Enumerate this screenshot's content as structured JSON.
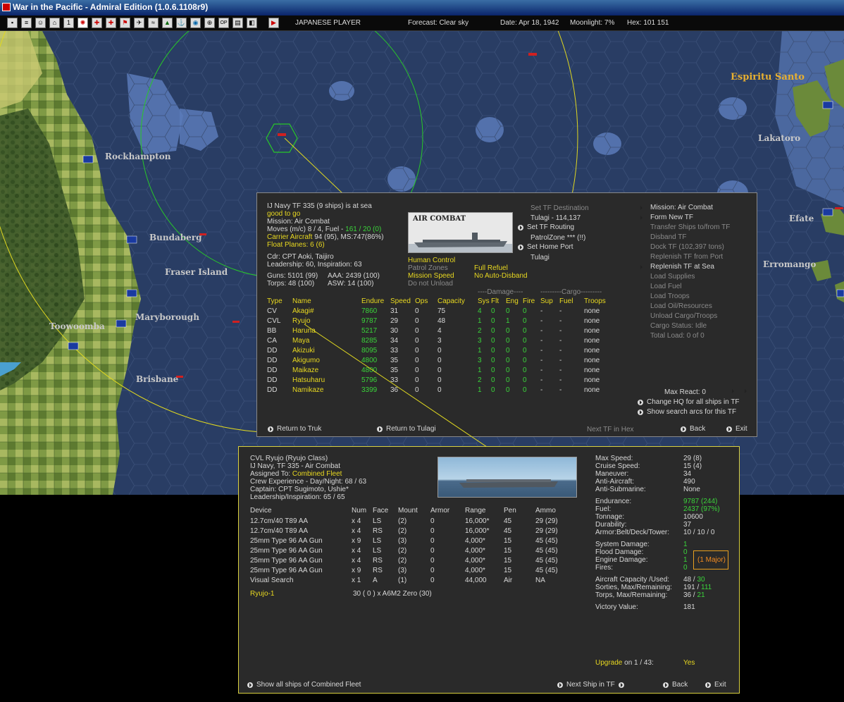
{
  "window": {
    "title": "War in the Pacific - Admiral Edition (1.0.6.1108r9)"
  },
  "topbar": {
    "player": "JAPANESE PLAYER",
    "forecast": "Forecast: Clear sky",
    "date": "Date: Apr 18, 1942",
    "moonlight": "Moonlight: 7%",
    "hex": "Hex: 101 151"
  },
  "map": {
    "labels": [
      "Rockhampton",
      "Bundaberg",
      "Fraser Island",
      "Maryborough",
      "Toowoomba",
      "Brisbane",
      "Espiritu Santo",
      "Lakatoro",
      "Efate",
      "Erromango"
    ]
  },
  "tf_panel": {
    "header": "IJ Navy TF 335 (9 ships) is at sea",
    "status": "good to go",
    "mission": "Mission: Air Combat",
    "moves": "Moves (m/c) 8 / 4, Fuel - ",
    "fuel": "161 / 20 (0)",
    "carrier": "Carrier Aircraft",
    "carrier_val": " 94 (95), MS:747(86%)",
    "float": "Float Planes: 6 (6)",
    "cdr": "Cdr: CPT Aoki, Taijiro",
    "leadership": "Leadership: 60, Inspiration: 63",
    "guns": "Guns: 5101 (99)",
    "aaa": "AAA: 2439 (100)",
    "torps": "Torps: 48 (100)",
    "asw": "ASW: 14 (100)",
    "image_caption": "AIR COMBAT",
    "human_control": "Human Control",
    "patrol_zones": "Patrol Zones",
    "mission_speed": "Mission Speed",
    "do_not_unload": "Do not Unload",
    "full_refuel": "Full Refuel",
    "no_auto_disband": "No Auto-Disband",
    "set_destination": "Set TF Destination",
    "destination": "Tulagi - 114,137",
    "set_routing": "Set TF Routing",
    "patrol_zone": "PatrolZone *** (!!)",
    "set_home": "Set Home Port",
    "home": "Tulagi",
    "right_menu": [
      {
        "label": "Mission: Air Combat",
        "active": true
      },
      {
        "label": "Form New TF",
        "active": true
      },
      {
        "label": "Transfer Ships to/from TF",
        "active": false
      },
      {
        "label": "Disband TF",
        "active": false
      },
      {
        "label": "Dock TF (102,397 tons)",
        "active": false
      },
      {
        "label": "Replenish TF from Port",
        "active": false
      },
      {
        "label": "Replenish TF at Sea",
        "active": true
      },
      {
        "label": "Load Supplies",
        "active": false
      },
      {
        "label": "Load Fuel",
        "active": false
      },
      {
        "label": "Load Troops",
        "active": false
      },
      {
        "label": "Load Oil/Resources",
        "active": false
      },
      {
        "label": "Unload Cargo/Troops",
        "active": false
      },
      {
        "label": "Cargo Status: Idle",
        "active": false
      },
      {
        "label": "Total Load: 0 of 0",
        "active": false
      }
    ],
    "group_damage": "----Damage----",
    "group_cargo": "---------Cargo---------",
    "columns": [
      "Type",
      "Name",
      "Endure",
      "Speed",
      "Ops",
      "Capacity",
      "Sys",
      "Flt",
      "Eng",
      "Fire",
      "Sup",
      "Fuel",
      "Troops"
    ],
    "ships": [
      [
        "CV",
        "Akagi#",
        "7860",
        "31",
        "0",
        "75",
        "4",
        "0",
        "0",
        "0",
        "-",
        "-",
        "none"
      ],
      [
        "CVL",
        "Ryujo",
        "9787",
        "29",
        "0",
        "48",
        "1",
        "0",
        "1",
        "0",
        "-",
        "-",
        "none"
      ],
      [
        "BB",
        "Haruna",
        "5217",
        "30",
        "0",
        "4",
        "2",
        "0",
        "0",
        "0",
        "-",
        "-",
        "none"
      ],
      [
        "CA",
        "Maya",
        "8285",
        "34",
        "0",
        "3",
        "3",
        "0",
        "0",
        "0",
        "-",
        "-",
        "none"
      ],
      [
        "DD",
        "Akizuki",
        "8095",
        "33",
        "0",
        "0",
        "1",
        "0",
        "0",
        "0",
        "-",
        "-",
        "none"
      ],
      [
        "DD",
        "Akigumo",
        "4800",
        "35",
        "0",
        "0",
        "3",
        "0",
        "0",
        "0",
        "-",
        "-",
        "none"
      ],
      [
        "DD",
        "Maikaze",
        "4800",
        "35",
        "0",
        "0",
        "1",
        "0",
        "0",
        "0",
        "-",
        "-",
        "none"
      ],
      [
        "DD",
        "Hatsuharu",
        "5796",
        "33",
        "0",
        "0",
        "2",
        "0",
        "0",
        "0",
        "-",
        "-",
        "none"
      ],
      [
        "DD",
        "Namikaze",
        "3399",
        "36",
        "0",
        "0",
        "1",
        "0",
        "0",
        "0",
        "-",
        "-",
        "none"
      ]
    ],
    "max_react": "Max React:  0",
    "change_hq": "Change HQ for all ships in TF",
    "show_search": "Show search arcs for this TF",
    "return_truk": "Return to Truk",
    "return_tulagi": "Return to Tulagi",
    "next_tf": "Next TF in Hex",
    "back": "Back",
    "exit": "Exit"
  },
  "ship_panel": {
    "title": "CVL Ryujo (Ryujo Class)",
    "tf": "IJ Navy, TF 335 - Air Combat",
    "assigned_label": "Assigned To: ",
    "assigned": "Combined Fleet",
    "crew": "Crew Experience - Day/Night: 68 / 63",
    "captain": "Captain: CPT Sugimoto, Ushie*",
    "leadership": "Leadership/Inspiration: 65 / 65",
    "columns": [
      "Device",
      "Num",
      "Face",
      "Mount",
      "Armor",
      "Range",
      "Pen",
      "Ammo"
    ],
    "devices": [
      [
        "12.7cm/40 T89 AA",
        "x 4",
        "LS",
        "(2)",
        "0",
        "16,000*",
        "45",
        "29  (29)"
      ],
      [
        "12.7cm/40 T89 AA",
        "x 4",
        "RS",
        "(2)",
        "0",
        "16,000*",
        "45",
        "29  (29)"
      ],
      [
        "25mm Type 96 AA Gun",
        "x 9",
        "LS",
        "(3)",
        "0",
        "4,000*",
        "15",
        "45  (45)"
      ],
      [
        "25mm Type 96 AA Gun",
        "x 4",
        "LS",
        "(2)",
        "0",
        "4,000*",
        "15",
        "45  (45)"
      ],
      [
        "25mm Type 96 AA Gun",
        "x 4",
        "RS",
        "(2)",
        "0",
        "4,000*",
        "15",
        "45  (45)"
      ],
      [
        "25mm Type 96 AA Gun",
        "x 9",
        "RS",
        "(3)",
        "0",
        "4,000*",
        "15",
        "45  (45)"
      ],
      [
        "Visual Search",
        "x 1",
        "A",
        "(1)",
        "0",
        "44,000",
        "Air",
        "NA"
      ]
    ],
    "airgroup_name": "Ryujo-1",
    "airgroup_val": "30 ( 0 ) x A6M2 Zero (30)",
    "stats": [
      [
        "Max Speed:",
        "29 (8)",
        "w"
      ],
      [
        "Cruise Speed:",
        "15 (4)",
        "w"
      ],
      [
        "Maneuver:",
        "34",
        "w"
      ],
      [
        "Anti-Aircraft:",
        "490",
        "w"
      ],
      [
        "Anti-Submarine:",
        "None",
        "w"
      ]
    ],
    "stats2": [
      [
        "Endurance:",
        "9787 (244)",
        "g"
      ],
      [
        "Fuel:",
        "2437 (97%)",
        "g"
      ],
      [
        "Tonnage:",
        "10600",
        "w"
      ],
      [
        "Durability:",
        "37",
        "w"
      ],
      [
        "Armor:Belt/Deck/Tower:",
        "10 / 10 / 0",
        "w"
      ]
    ],
    "damage": [
      [
        "System Damage:",
        "1"
      ],
      [
        "Flood Damage:",
        "0"
      ],
      [
        "Engine Damage:",
        "1"
      ],
      [
        "Fires:",
        "0"
      ]
    ],
    "major": "(1 Major)",
    "aircraft_cap_label": "Aircraft Capacity /Used:",
    "aircraft_cap": "48 / ",
    "aircraft_used": "30",
    "sorties_label": "Sorties, Max/Remaining:",
    "sorties": "191 / ",
    "sorties_rem": "111",
    "torps_label": "Torps, Max/Remaining:",
    "torps": "36 / ",
    "torps_rem": "21",
    "victory_label": "Victory Value:",
    "victory": "181",
    "upgrade": "Upgrade",
    "upgrade_on": " on  1 / 43:",
    "upgrade_yes": "Yes",
    "show_all": "Show all ships of Combined Fleet",
    "next_ship": "Next Ship in TF",
    "back": "Back",
    "exit": "Exit"
  },
  "colors": {
    "yellow": "#e8d820",
    "green": "#3ad43a",
    "orange": "#f08a20",
    "panel": "#2a2a2a",
    "sea": "#293d64",
    "land": "#6b8a3a"
  }
}
